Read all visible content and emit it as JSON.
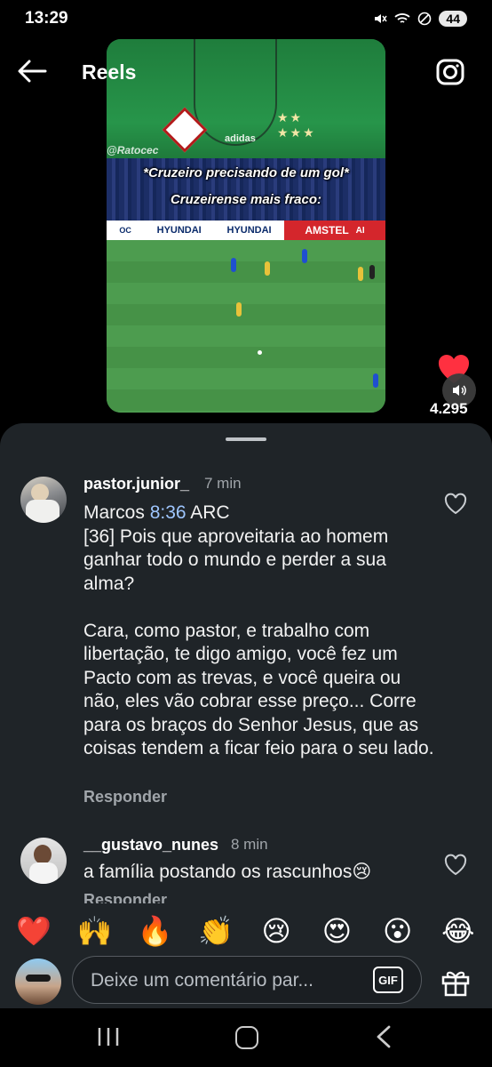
{
  "status_bar": {
    "time": "13:29",
    "battery": "44",
    "icons": [
      "mute-icon",
      "wifi-icon",
      "dnd-icon",
      "battery-icon"
    ]
  },
  "header": {
    "title": "Reels",
    "back_icon": "arrow-left-icon",
    "camera_icon": "camera-icon"
  },
  "video": {
    "watermark": "@Ratocec",
    "caption_line1": "*Cruzeiro precisando de um gol*",
    "caption_line2": "Cruzeirense mais fraco:",
    "jersey_brand": "adidas",
    "ad_left": "HYUNDAI",
    "ad_left2": "HYUNDAI",
    "ad_right": "AMSTEL",
    "ad_edge": "OC",
    "ad_edge2": "AI"
  },
  "actions": {
    "like_count": "4.295",
    "like_icon": "heart-filled-icon",
    "volume_icon": "volume-icon"
  },
  "comments": [
    {
      "username": "pastor.junior_",
      "time": "7 min",
      "ref_prefix": "Marcos ",
      "ref_link": "8:36",
      "ref_suffix": " ARC",
      "paragraph1": "[36] Pois que aproveitaria ao homem ganhar todo o mundo e perder a sua alma?",
      "paragraph2": "Cara, como pastor, e trabalho com libertação, te digo amigo, você fez um Pacto com as trevas, e você queira ou não, eles vão cobrar esse preço... Corre para os braços do Senhor Jesus, que as coisas tendem a ficar feio para o seu lado.",
      "reply": "Responder"
    },
    {
      "username": "__gustavo_nunes",
      "time": "8 min",
      "text": "a família postando os rascunhos😢",
      "reply": "Responder"
    }
  ],
  "emoji_bar": [
    "❤️",
    "🙌",
    "🔥",
    "👏",
    "😢",
    "😍",
    "😮",
    "😂"
  ],
  "composer": {
    "placeholder": "Deixe um comentário par...",
    "gif_label": "GIF"
  },
  "colors": {
    "sheet_bg": "#1f2428",
    "like_red": "#ff3040",
    "link_blue": "#9ec6ff",
    "muted_text": "#a0a5aa"
  }
}
